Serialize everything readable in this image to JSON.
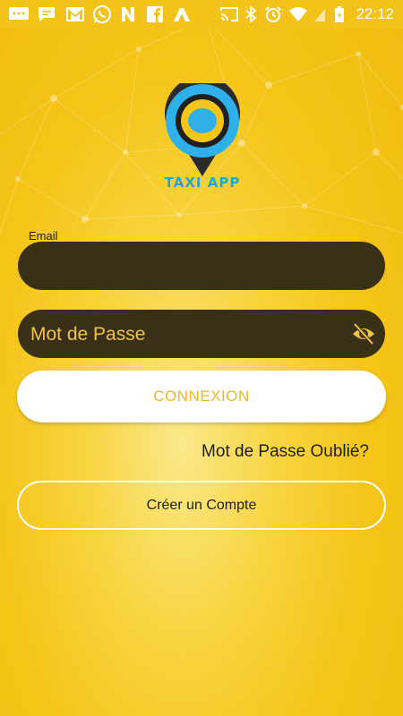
{
  "status_bar": {
    "time": "22:12",
    "icons": [
      "message-icon",
      "chat-icon",
      "gmail-icon",
      "whatsapp-icon",
      "n-app-icon",
      "facebook-icon",
      "a-app-icon",
      "cast-icon",
      "bluetooth-icon",
      "alarm-icon",
      "wifi-icon",
      "battery-charging-icon"
    ]
  },
  "logo": {
    "text": "TAXI APP",
    "colors": {
      "ring": "#2fb0ea",
      "pin": "#2b2b2b",
      "inner": "#f5c518",
      "text": "#29a3d6"
    }
  },
  "form": {
    "email_label": "Email",
    "email_value": "",
    "password_placeholder": "Mot de Passe",
    "password_value": ""
  },
  "buttons": {
    "login": "CONNEXION",
    "forgot": "Mot de Passe Oublié?",
    "create_account": "Créer un Compte"
  },
  "colors": {
    "background": "#f5c518",
    "field_bg": "#3a2f17",
    "placeholder": "#f0c24a",
    "login_text": "#e6b82a"
  }
}
